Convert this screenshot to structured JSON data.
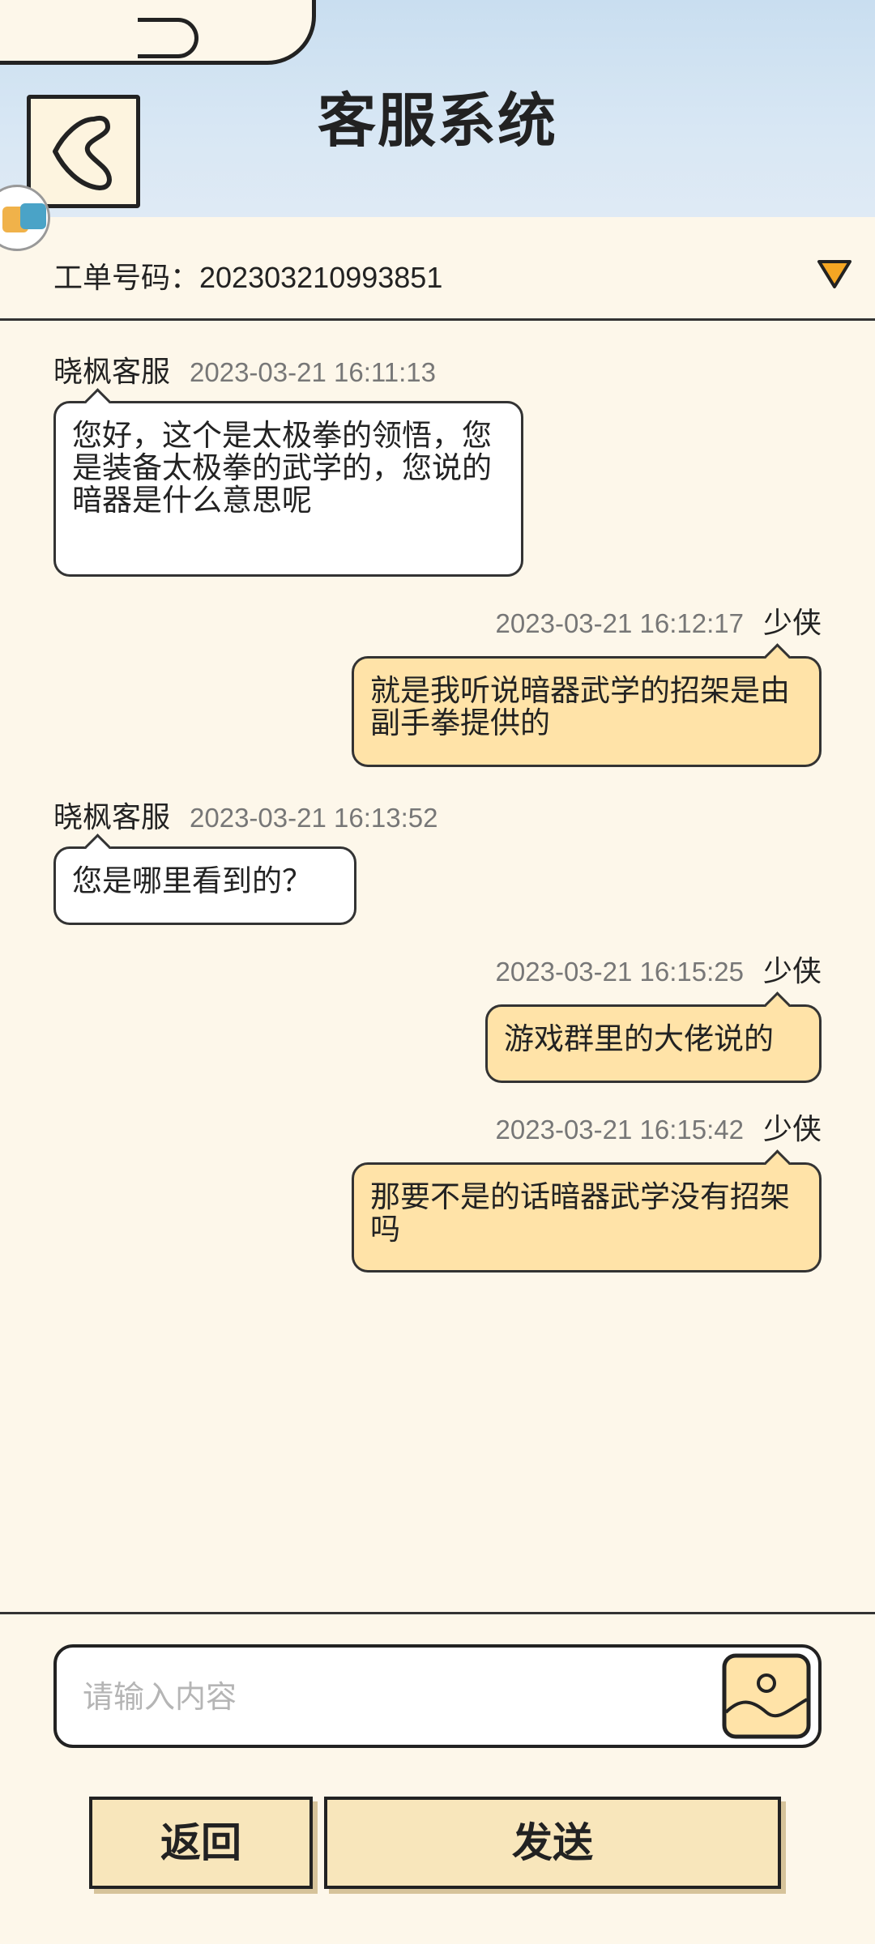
{
  "header": {
    "title": "客服系统",
    "back_icon": "back-chevron-icon",
    "background_color": "#d6e6f4"
  },
  "floating_widget": {
    "icon": "chat-widget-icon"
  },
  "ticket": {
    "label": "工单号码：",
    "number": "202303210993851",
    "toggle_icon": "triangle-down-icon",
    "toggle_color": "#f5a623"
  },
  "messages": [
    {
      "side": "left",
      "sender": "晓枫客服",
      "time": "2023-03-21 16:11:13",
      "text": "您好，这个是太极拳的领悟，您是装备太极拳的武学的，您说的暗器是什么意思呢"
    },
    {
      "side": "right",
      "sender": "少侠",
      "time": "2023-03-21 16:12:17",
      "text": "就是我听说暗器武学的招架是由副手拳提供的"
    },
    {
      "side": "left",
      "sender": "晓枫客服",
      "time": "2023-03-21 16:13:52",
      "text": "您是哪里看到的？"
    },
    {
      "side": "right",
      "sender": "少侠",
      "time": "2023-03-21 16:15:25",
      "text": "游戏群里的大佬说的"
    },
    {
      "side": "right",
      "sender": "少侠",
      "time": "2023-03-21 16:15:42",
      "text": "那要不是的话暗器武学没有招架吗"
    }
  ],
  "composer": {
    "placeholder": "请输入内容",
    "value": "",
    "image_icon": "image-upload-icon"
  },
  "actions": {
    "back_label": "返回",
    "send_label": "发送"
  },
  "colors": {
    "background": "#fdf7ea",
    "user_bubble": "#ffe3a8",
    "agent_bubble": "#ffffff",
    "button": "#f8e6bb"
  }
}
